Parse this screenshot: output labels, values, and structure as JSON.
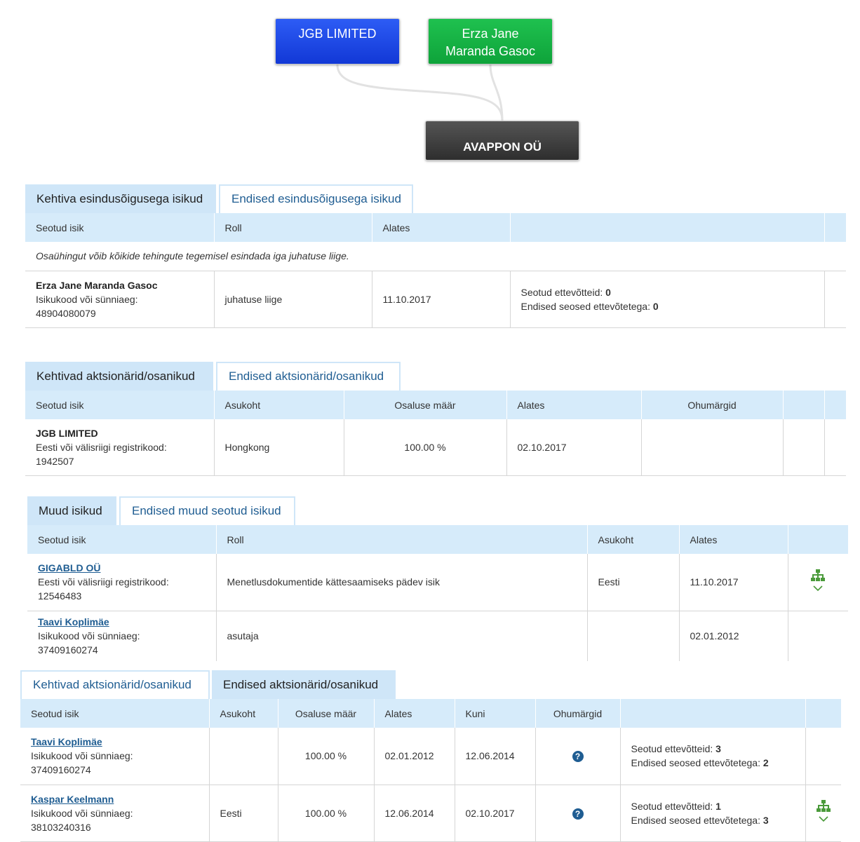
{
  "graph": {
    "node1": [
      "JGB LIMITED"
    ],
    "node2": [
      "Erza Jane",
      "Maranda Gasoc"
    ],
    "node3": "AVAPPON OÜ"
  },
  "section1": {
    "tab_active": "Kehtiva esindusõigusega isikud",
    "tab_inactive": "Endised esindusõigusega isikud",
    "headers": [
      "Seotud isik",
      "Roll",
      "Alates",
      "",
      ""
    ],
    "note": "Osaühingut võib kõikide tehingute tegemisel esindada iga juhatuse liige.",
    "row": {
      "name": "Erza Jane Maranda Gasoc",
      "id_label": "Isikukood või sünniaeg:",
      "id_value": "48904080079",
      "role": "juhatuse liige",
      "since": "11.10.2017",
      "related_label": "Seotud ettevõtteid:",
      "related_value": "0",
      "former_label": "Endised seosed ettevõtetega:",
      "former_value": "0"
    }
  },
  "section2": {
    "tab_active": "Kehtivad aktsionärid/osanikud",
    "tab_inactive": "Endised aktsionärid/osanikud",
    "headers": [
      "Seotud isik",
      "Asukoht",
      "Osaluse määr",
      "Alates",
      "Ohumärgid",
      "",
      ""
    ],
    "row": {
      "name": "JGB LIMITED",
      "id_label": "Eesti või välisriigi registrikood:",
      "id_value": "1942507",
      "location": "Hongkong",
      "share": "100.00 %",
      "since": "02.10.2017"
    }
  },
  "section3": {
    "tab_active": "Muud isikud",
    "tab_inactive": "Endised muud seotud isikud",
    "headers": [
      "Seotud isik",
      "Roll",
      "Asukoht",
      "Alates",
      ""
    ],
    "rows": [
      {
        "name": "GIGABLD OÜ",
        "id_label": "Eesti või välisriigi registrikood:",
        "id_value": "12546483",
        "role": "Menetlusdokumentide kättesaamiseks pädev isik",
        "location": "Eesti",
        "since": "11.10.2017"
      },
      {
        "name": "Taavi Koplimäe",
        "id_label": "Isikukood või sünniaeg:",
        "id_value": "37409160274",
        "role": "asutaja",
        "location": "",
        "since": "02.01.2012"
      }
    ]
  },
  "section4": {
    "tab_inactive": "Kehtivad aktsionärid/osanikud",
    "tab_active": "Endised aktsionärid/osanikud",
    "headers": [
      "Seotud isik",
      "Asukoht",
      "Osaluse määr",
      "Alates",
      "Kuni",
      "Ohumärgid",
      "",
      ""
    ],
    "rows": [
      {
        "name": "Taavi Koplimäe",
        "id_label": "Isikukood või sünniaeg:",
        "id_value": "37409160274",
        "location": "",
        "share": "100.00 %",
        "since": "02.01.2012",
        "until": "12.06.2014",
        "related_label": "Seotud ettevõtteid:",
        "related_value": "3",
        "former_label": "Endised seosed ettevõtetega:",
        "former_value": "2"
      },
      {
        "name": "Kaspar Keelmann",
        "id_label": "Isikukood või sünniaeg:",
        "id_value": "38103240316",
        "location": "Eesti",
        "share": "100.00 %",
        "since": "12.06.2014",
        "until": "02.10.2017",
        "related_label": "Seotud ettevõtteid:",
        "related_value": "1",
        "former_label": "Endised seosed ettevõtetega:",
        "former_value": "3"
      }
    ]
  },
  "icons": {
    "question": "?",
    "chevron": "⌄"
  },
  "colors": {
    "node_blue": "#1d46e6",
    "node_green": "#16b244",
    "node_dark": "#3c3c3c",
    "tab_blue": "#cfe6f8",
    "link": "#1f5d92",
    "hierarchy_icon": "#4a9a3a"
  }
}
